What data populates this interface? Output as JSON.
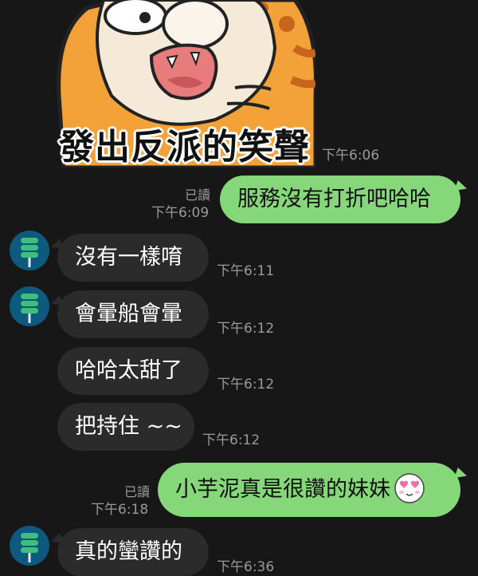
{
  "colors": {
    "background": "#171717",
    "incoming_bubble": "#2b2b2b",
    "outgoing_bubble": "#86d77a",
    "meta_text": "#9a9a9a",
    "avatar": "#0d5a7e"
  },
  "sticker": {
    "caption": "發出反派的笑聲",
    "time": "下午6:06"
  },
  "messages": [
    {
      "direction": "out",
      "text": "服務沒有打折吧哈哈",
      "read": "已讀",
      "time": "下午6:09"
    },
    {
      "direction": "in",
      "text": "沒有一樣唷",
      "time": "下午6:11"
    },
    {
      "direction": "in",
      "text": "會暈船會暈",
      "time": "下午6:12"
    },
    {
      "direction": "in",
      "text": "哈哈太甜了",
      "time": "下午6:12"
    },
    {
      "direction": "in",
      "text": "把持住 ~~",
      "time": "下午6:12"
    },
    {
      "direction": "out",
      "text": "小芋泥真是很讚的妹妹",
      "emoji": "heart-eyes-icon",
      "read": "已讀",
      "time": "下午6:18"
    },
    {
      "direction": "in",
      "text": "真的蠻讚的",
      "time": "下午6:36"
    }
  ]
}
